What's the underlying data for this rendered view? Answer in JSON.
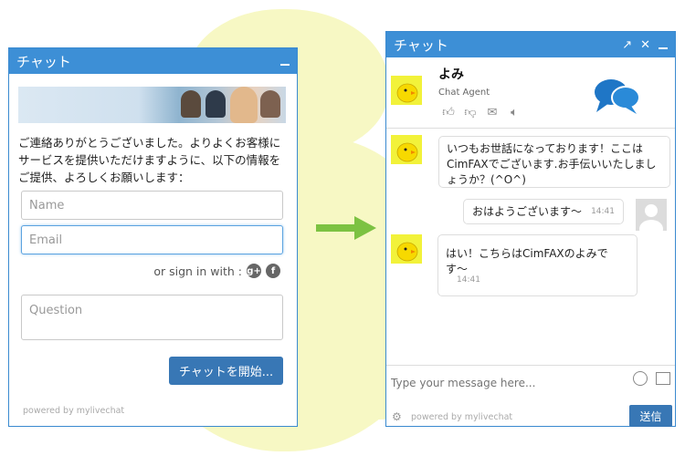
{
  "left_widget": {
    "title": "チャット",
    "intro_text": "ご連絡ありがとうございました。よりよくお客様にサービスを提供いただけますように、以下の情報をご提供、よろしくお願いします：",
    "name_placeholder": "Name",
    "email_placeholder": "Email",
    "signin_label": "or sign in with :",
    "question_placeholder": "Question",
    "start_button": "チャットを開始...",
    "powered_by": "powered by mylivechat"
  },
  "right_widget": {
    "title": "チャット",
    "agent_name": "よみ",
    "agent_role": "Chat Agent",
    "messages": [
      {
        "text": "いつもお世話になっております！ここはCimFAXでございます.お手伝いいたしましょうか？(^O^)"
      },
      {
        "text": "おはようございます〜",
        "time": "14:41"
      },
      {
        "text": "はい！こちらはCimFAXのよみです〜",
        "time": "14:41"
      }
    ],
    "input_placeholder": "Type your message here...",
    "powered_by": "powered by mylivechat",
    "send_button": "送信"
  },
  "colors": {
    "header": "#3d8fd6",
    "button": "#3877b5",
    "blob": "#f7f8c4",
    "arrow": "#7cc242"
  }
}
